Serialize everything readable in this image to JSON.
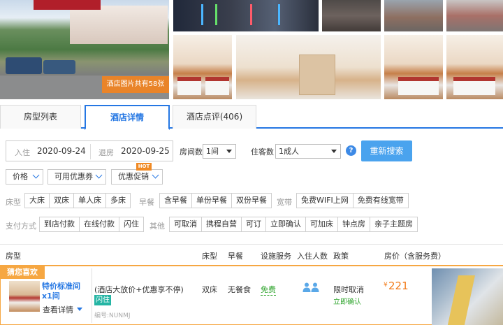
{
  "gallery": {
    "photo_count_label": "酒店图片共有58张"
  },
  "tabs": [
    {
      "label": "房型列表"
    },
    {
      "label": "酒店详情"
    },
    {
      "label": "酒店点评(406)"
    }
  ],
  "search": {
    "checkin_label": "入住",
    "checkin_value": "2020-09-24",
    "checkout_label": "退房",
    "checkout_value": "2020-09-25",
    "rooms_label": "房间数",
    "rooms_value": "1间",
    "guests_label": "住客数",
    "guests_value": "1成人",
    "help": "?",
    "search_button": "重新搜索"
  },
  "dropdowns": [
    {
      "label": "价格"
    },
    {
      "label": "可用优惠券"
    },
    {
      "label": "优惠促销"
    }
  ],
  "hot_badge": "HOT",
  "filters": {
    "bed_label": "床型",
    "bed": [
      "大床",
      "双床",
      "单人床",
      "多床"
    ],
    "breakfast_label": "早餐",
    "breakfast": [
      "含早餐",
      "单份早餐",
      "双份早餐"
    ],
    "broadband_label": "宽带",
    "broadband": [
      "免费WIFI上网",
      "免费有线宽带"
    ],
    "payment_label": "支付方式",
    "payment": [
      "到店付款",
      "在线付款",
      "闪住"
    ],
    "other_label": "其他",
    "other": [
      "可取消",
      "携程自营",
      "可订",
      "立即确认",
      "可加床",
      "钟点房",
      "亲子主题房"
    ]
  },
  "table": {
    "headers": {
      "room_type": "房型",
      "bed": "床型",
      "breakfast": "早餐",
      "facilities": "设施服务",
      "occupancy": "入住人数",
      "policy": "政策",
      "price": "房价（含服务费）"
    }
  },
  "room": {
    "tag": "猜您喜欢",
    "name": "特价标准间x1间",
    "details": "查看详情",
    "rate_name": "(酒店大放价+优惠享不停)",
    "flash_tag": "闪住",
    "code": "编号:NUNMJ",
    "bed": "双床",
    "breakfast": "无餐食",
    "facility": "免费",
    "policy": "限时取消",
    "policy_sub": "立即确认",
    "currency": "¥",
    "price": "221"
  },
  "colors": {
    "accent": "#2577e3",
    "orange": "#f6a742",
    "price": "#f27b1a",
    "green": "#33a631"
  }
}
